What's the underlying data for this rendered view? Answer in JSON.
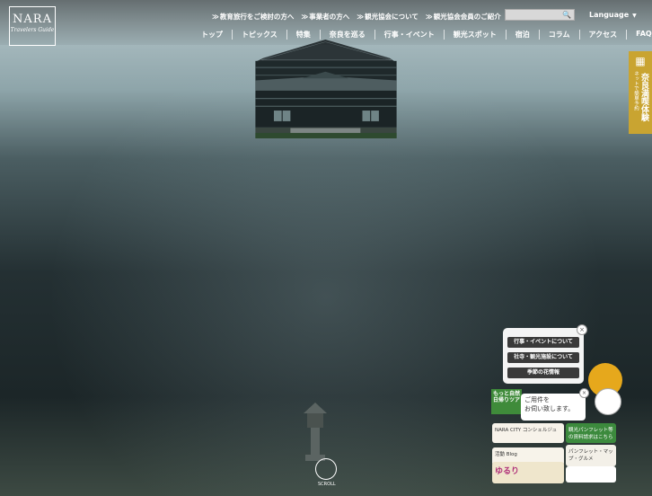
{
  "brand": {
    "title": "NARA",
    "subtitle": "Travelers Guide"
  },
  "utility_links": [
    "教育旅行をご検討の方へ",
    "事業者の方へ",
    "観光協会について",
    "観光協会会員のご紹介"
  ],
  "search": {
    "placeholder": ""
  },
  "language": {
    "label": "Language"
  },
  "nav": [
    "トップ",
    "トピックス",
    "特集",
    "奈良を巡る",
    "行事・イベント",
    "観光スポット",
    "宿泊",
    "コラム",
    "アクセス",
    "FAQ"
  ],
  "side_tab": {
    "small": "ネットで簡単予約",
    "big": "奈良満喫体験"
  },
  "popup": {
    "items": [
      "行事・イベントについて",
      "社寺・観光施設について",
      "季節の花情報"
    ]
  },
  "chat": {
    "line1": "ご用件を",
    "line2": "お伺い致します。"
  },
  "green_button": {
    "line1": "もっと自然",
    "line2": "日帰りツア"
  },
  "banners": {
    "concierge_title": "NARA CITY コンシェルジュ",
    "concierge_sub": "活動 Blog",
    "pamphlet": "観光パンフレット等の資料請求はこちら",
    "yururi": "ゆるり",
    "pamphlet_sub": "パンフレット・マップ・グルメ"
  },
  "scroll": {
    "label": "SCROLL"
  },
  "colors": {
    "accent": "#c9a431",
    "green": "#3f8b3a",
    "dark_button": "#3a3a3a"
  },
  "icons": {
    "search": "search-icon",
    "calendar": "calendar-icon",
    "close": "close-icon"
  }
}
